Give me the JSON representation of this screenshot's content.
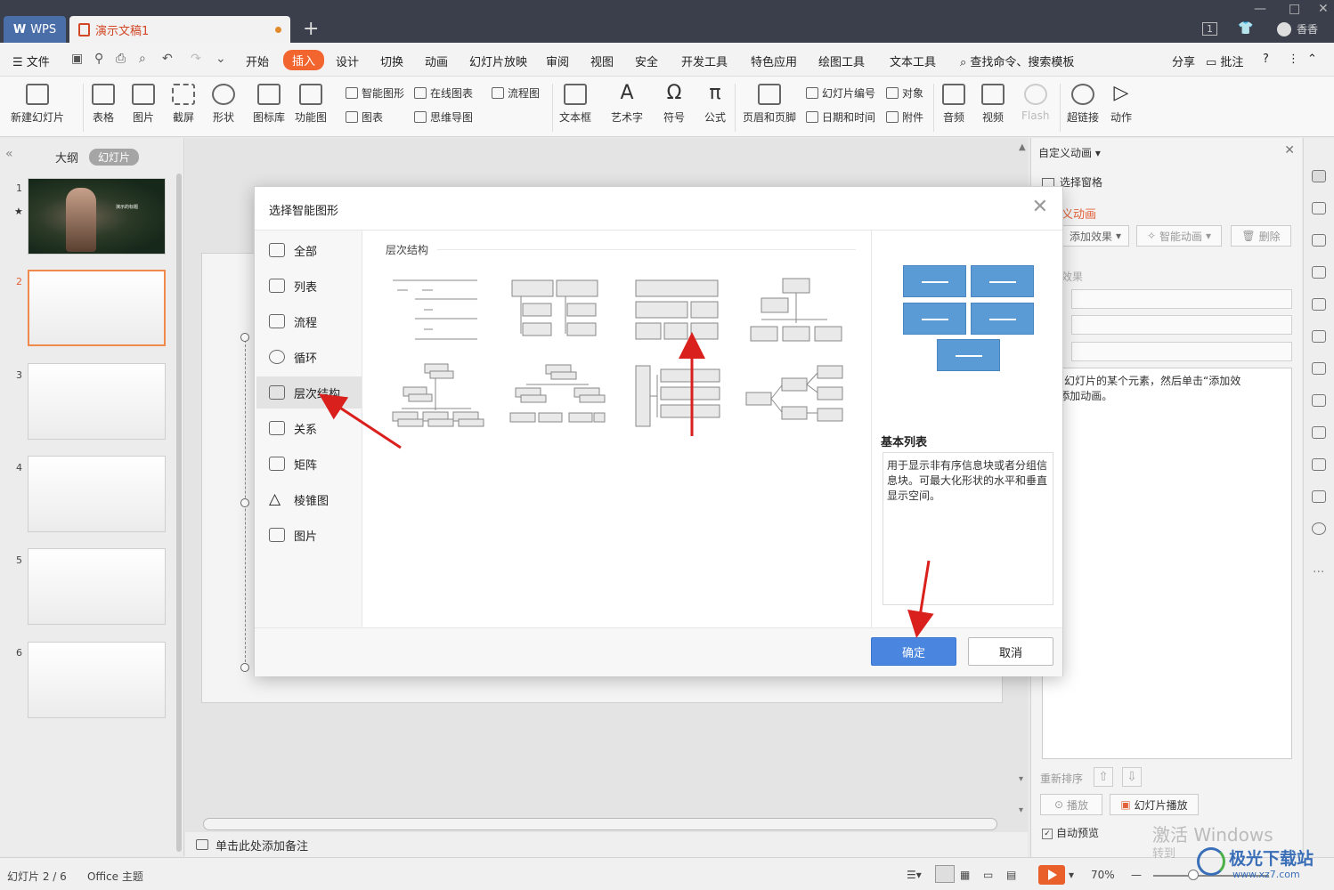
{
  "titlebar": {
    "app_tab": "WPS",
    "doc_tab": "演示文稿1",
    "new_tab": "+",
    "page_badge": "1",
    "user_name": "香香"
  },
  "menu": {
    "file": "文件",
    "items": [
      "开始",
      "插入",
      "设计",
      "切换",
      "动画",
      "幻灯片放映",
      "审阅",
      "视图",
      "安全",
      "开发工具",
      "特色应用",
      "绘图工具",
      "文本工具"
    ],
    "active": "插入",
    "search": "查找命令、搜索模板",
    "share": "分享",
    "comment": "批注",
    "help": "?"
  },
  "ribbon": {
    "new_slide": "新建幻灯片",
    "table": "表格",
    "picture": "图片",
    "screenshot": "截屏",
    "shape": "形状",
    "icon_lib": "图标库",
    "function_chart": "功能图",
    "smartart": "智能图形",
    "online_chart": "在线图表",
    "flowchart": "流程图",
    "chart": "图表",
    "mindmap": "思维导图",
    "textbox": "文本框",
    "wordart": "艺术字",
    "symbol": "符号",
    "formula": "公式",
    "header_footer": "页眉和页脚",
    "slide_number": "幻灯片编号",
    "object": "对象",
    "date_time": "日期和时间",
    "attachment": "附件",
    "audio": "音频",
    "video": "视频",
    "flash": "Flash",
    "hyperlink": "超链接",
    "action": "动作"
  },
  "left_panel": {
    "tab_outline": "大纲",
    "tab_slides": "幻灯片",
    "slides": [
      "1",
      "2",
      "3",
      "4",
      "5",
      "6"
    ],
    "selected": "2",
    "slide1_caption": "演示的标题"
  },
  "notes": {
    "placeholder": "单击此处添加备注"
  },
  "right_panel": {
    "title": "自定义动画",
    "selection_pane": "选择窗格",
    "section": "义动画",
    "add_effect": "添加效果",
    "smart_anim": "智能动画",
    "delete": "删除",
    "effect_label": "效果",
    "hint_line1": "中幻灯片的某个元素，然后单击“添加效",
    "hint_line2": "”添加动画。",
    "reorder": "重新排序",
    "play": "播放",
    "slideshow": "幻灯片播放",
    "auto_preview": "自动预览"
  },
  "dialog": {
    "title": "选择智能图形",
    "categories": [
      {
        "label": "全部",
        "icon": "all-icon"
      },
      {
        "label": "列表",
        "icon": "list-icon"
      },
      {
        "label": "流程",
        "icon": "process-icon"
      },
      {
        "label": "循环",
        "icon": "cycle-icon"
      },
      {
        "label": "层次结构",
        "icon": "hierarchy-icon"
      },
      {
        "label": "关系",
        "icon": "relationship-icon"
      },
      {
        "label": "矩阵",
        "icon": "matrix-icon"
      },
      {
        "label": "棱锥图",
        "icon": "pyramid-icon"
      },
      {
        "label": "图片",
        "icon": "picture-icon"
      }
    ],
    "selected_category": "层次结构",
    "section_title": "层次结构",
    "preview_name": "基本列表",
    "preview_desc": "用于显示非有序信息块或者分组信息块。可最大化形状的水平和垂直显示空间。",
    "ok": "确定",
    "cancel": "取消"
  },
  "status": {
    "slide_pos": "幻灯片 2 / 6",
    "theme": "Office 主题",
    "zoom": "70%",
    "watermark": "激活 Windows",
    "watermark2": "转到",
    "site_logo": "极光下载站",
    "site_url": "www.xz7.com"
  },
  "colors": {
    "accent": "#f2652f",
    "ok_button": "#4a86e0",
    "preview_box": "#5b9bd5",
    "annotation_arrow": "#d9201c"
  }
}
